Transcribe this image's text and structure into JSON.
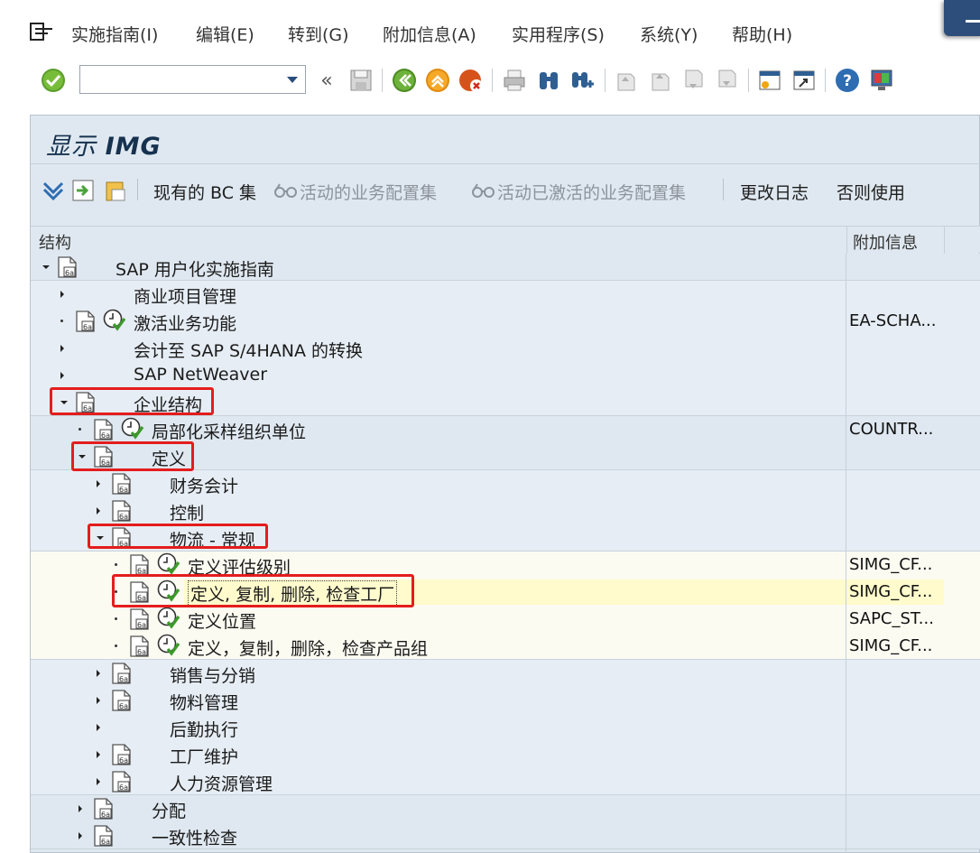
{
  "menubar": {
    "items": [
      "实施指南(I)",
      "编辑(E)",
      "转到(G)",
      "附加信息(A)",
      "实用程序(S)",
      "系统(Y)",
      "帮助(H)"
    ]
  },
  "toolbar": {
    "command_field_value": "",
    "icons": [
      "enter-icon",
      "back-icon",
      "save-icon",
      "back-green-icon",
      "exit-icon",
      "cancel-icon",
      "print-icon",
      "find-icon",
      "find-next-icon",
      "first-page-icon",
      "prev-page-icon",
      "next-page-icon",
      "last-page-icon",
      "create-session-icon",
      "shortcut-icon",
      "help-icon",
      "layout-icon"
    ]
  },
  "page": {
    "title_prefix": "显示",
    "title_main": "IMG"
  },
  "app_toolbar": {
    "existing_bc": "现有的 BC 集",
    "active_bc": "活动的业务配置集",
    "activated_bc": "活动已激活的业务配置集",
    "change_log": "更改日志",
    "else_use": "否则使用"
  },
  "tree": {
    "col_structure": "结构",
    "col_extra": "附加信息",
    "rows": [
      {
        "label": "SAP 用户化实施指南",
        "extra": ""
      },
      {
        "label": "商业项目管理",
        "extra": ""
      },
      {
        "label": "激活业务功能",
        "extra": "EA-SCHA..."
      },
      {
        "label": "会计至 SAP S/4HANA 的转换",
        "extra": ""
      },
      {
        "label": "SAP NetWeaver",
        "extra": ""
      },
      {
        "label": "企业结构",
        "extra": ""
      },
      {
        "label": "局部化采样组织单位",
        "extra": "COUNTR..."
      },
      {
        "label": "定义",
        "extra": ""
      },
      {
        "label": "财务会计",
        "extra": ""
      },
      {
        "label": "控制",
        "extra": ""
      },
      {
        "label": "物流 - 常规",
        "extra": ""
      },
      {
        "label": "定义评估级别",
        "extra": "SIMG_CF..."
      },
      {
        "label": "定义, 复制, 删除, 检查工厂",
        "extra": "SIMG_CF..."
      },
      {
        "label": "定义位置",
        "extra": "SAPC_ST..."
      },
      {
        "label": "定义，复制，删除，检查产品组",
        "extra": "SIMG_CF..."
      },
      {
        "label": "销售与分销",
        "extra": ""
      },
      {
        "label": "物料管理",
        "extra": ""
      },
      {
        "label": "后勤执行",
        "extra": ""
      },
      {
        "label": "工厂维护",
        "extra": ""
      },
      {
        "label": "人力资源管理",
        "extra": ""
      },
      {
        "label": "分配",
        "extra": ""
      },
      {
        "label": "一致性检查",
        "extra": ""
      }
    ]
  }
}
